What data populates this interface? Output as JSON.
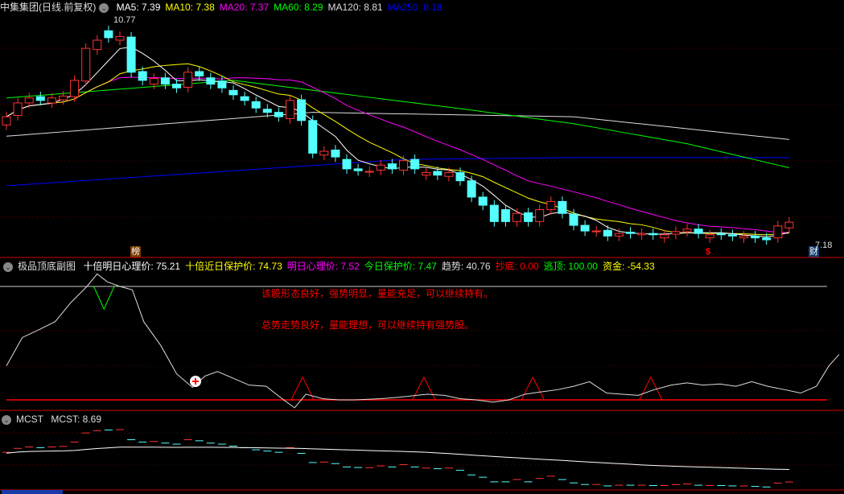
{
  "main": {
    "title": "中集集团(日线.前复权)",
    "ma": [
      {
        "label": "MA5: 7.39",
        "color": "#ffffff"
      },
      {
        "label": "MA10: 7.38",
        "color": "#ffff00"
      },
      {
        "label": "MA20: 7.37",
        "color": "#ff00ff"
      },
      {
        "label": "MA60: 8.29",
        "color": "#00ff00"
      },
      {
        "label": "MA120: 8.81",
        "color": "#dddddd"
      },
      {
        "label": "MA250: 8.18",
        "color": "#0000ff"
      }
    ],
    "high_label": "10.77",
    "low_label": "7.18",
    "badge_rank": "榜",
    "badge_money": "$",
    "badge_finance": "财"
  },
  "sub1": {
    "title": "极品顶底副图",
    "values": [
      {
        "label": "十倍明日心理价: 75.21",
        "color": "#ffffff"
      },
      {
        "label": "十倍近日保护价: 74.73",
        "color": "#ffff00"
      },
      {
        "label": "明日心理价: 7.52",
        "color": "#ff00ff"
      },
      {
        "label": "今日保护价: 7.47",
        "color": "#00ff00"
      },
      {
        "label": "趋势: 40.76",
        "color": "#dddddd"
      },
      {
        "label": "抄底: 0.00",
        "color": "#ff0000"
      },
      {
        "label": "逃顶: 100.00",
        "color": "#00ff00"
      },
      {
        "label": "资金: -54.33",
        "color": "#ffff00"
      }
    ],
    "message1": "该股形态良好，强势明显，量能充足，可以继续持有。",
    "message2": "总势走势良好，量能理想，可以继续持有强势股。"
  },
  "sub2": {
    "title": "MCST",
    "value_label": "MCST: 8.69"
  },
  "chart_data": {
    "type": "candlestick",
    "price_range": [
      7.18,
      10.77
    ],
    "closes": [
      9.23,
      9.45,
      9.53,
      9.49,
      9.53,
      9.56,
      9.81,
      10.32,
      10.45,
      10.49,
      10.51,
      9.94,
      9.81,
      9.84,
      9.75,
      9.69,
      9.94,
      9.88,
      9.75,
      9.69,
      9.58,
      9.49,
      9.37,
      9.3,
      9.23,
      9.49,
      9.17,
      8.65,
      8.68,
      8.59,
      8.4,
      8.37,
      8.36,
      8.46,
      8.4,
      8.53,
      8.4,
      8.34,
      8.3,
      8.34,
      8.21,
      7.95,
      7.82,
      7.56,
      7.56,
      7.69,
      7.56,
      7.75,
      7.88,
      7.69,
      7.5,
      7.41,
      7.41,
      7.33,
      7.37,
      7.37,
      7.37,
      7.35,
      7.35,
      7.4,
      7.44,
      7.37,
      7.35,
      7.35,
      7.33,
      7.33,
      7.3,
      7.27,
      7.49,
      7.55
    ],
    "opens": [
      9.1,
      9.25,
      9.45,
      9.55,
      9.45,
      9.5,
      9.55,
      9.8,
      10.3,
      10.6,
      10.45,
      10.5,
      9.95,
      9.75,
      9.85,
      9.75,
      9.7,
      9.95,
      9.85,
      9.8,
      9.65,
      9.55,
      9.47,
      9.35,
      9.3,
      9.2,
      9.5,
      9.17,
      8.62,
      8.7,
      8.55,
      8.4,
      8.35,
      8.38,
      8.48,
      8.38,
      8.55,
      8.3,
      8.36,
      8.28,
      8.34,
      8.21,
      7.95,
      7.82,
      7.75,
      7.56,
      7.7,
      7.56,
      7.75,
      7.88,
      7.68,
      7.5,
      7.4,
      7.42,
      7.33,
      7.39,
      7.35,
      7.37,
      7.3,
      7.36,
      7.4,
      7.44,
      7.3,
      7.37,
      7.35,
      7.3,
      7.33,
      7.3,
      7.3,
      7.46
    ],
    "ma60": [
      [
        0,
        9.53
      ],
      [
        20,
        9.81
      ],
      [
        40,
        9.36
      ],
      [
        50,
        9.12
      ],
      [
        60,
        8.8
      ],
      [
        72,
        8.29
      ]
    ],
    "ma120": [
      [
        0,
        8.92
      ],
      [
        27,
        9.3
      ],
      [
        50,
        9.23
      ],
      [
        72,
        8.81
      ]
    ],
    "ma250": [
      [
        0,
        8.13
      ],
      [
        35,
        8.55
      ],
      [
        50,
        8.58
      ],
      [
        72,
        8.58
      ]
    ],
    "sub1_white": [
      [
        0,
        30
      ],
      [
        1.4,
        55
      ],
      [
        2.9,
        62
      ],
      [
        4.3,
        69
      ],
      [
        5.7,
        86
      ],
      [
        7.1,
        100
      ],
      [
        8,
        111
      ],
      [
        8.9,
        104
      ],
      [
        10,
        100
      ],
      [
        11.1,
        97
      ],
      [
        12.1,
        69
      ],
      [
        13.6,
        48
      ],
      [
        15,
        23
      ],
      [
        16.4,
        11
      ],
      [
        17.5,
        21
      ],
      [
        18.6,
        25
      ],
      [
        20,
        19
      ],
      [
        21.4,
        13
      ],
      [
        22.9,
        12
      ],
      [
        24.3,
        1
      ],
      [
        25.4,
        -7
      ],
      [
        26.4,
        5
      ],
      [
        27.9,
        1
      ],
      [
        29.3,
        0
      ],
      [
        30.7,
        0
      ],
      [
        32.9,
        1
      ],
      [
        34.3,
        2
      ],
      [
        37.1,
        5
      ],
      [
        38.6,
        4
      ],
      [
        40,
        1
      ],
      [
        41.4,
        0
      ],
      [
        42.9,
        -2
      ],
      [
        44.3,
        0
      ],
      [
        45.7,
        5
      ],
      [
        47.1,
        7
      ],
      [
        48.6,
        9
      ],
      [
        50,
        12
      ],
      [
        51.4,
        16
      ],
      [
        52.9,
        6
      ],
      [
        54.3,
        5
      ],
      [
        55.7,
        4
      ],
      [
        57.1,
        9
      ],
      [
        58.6,
        13
      ],
      [
        60,
        15
      ],
      [
        61.4,
        13
      ],
      [
        62.9,
        14
      ],
      [
        64.3,
        12
      ],
      [
        65.7,
        16
      ],
      [
        67.1,
        12
      ],
      [
        68.6,
        9
      ],
      [
        70,
        6
      ],
      [
        71.4,
        12
      ],
      [
        72.5,
        30
      ],
      [
        73.4,
        40
      ]
    ],
    "sub1_red_peaks": [
      26.1,
      36.8,
      46.4,
      56.8
    ]
  }
}
